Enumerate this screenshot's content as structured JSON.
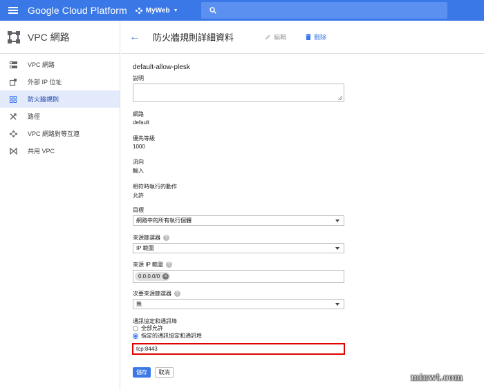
{
  "topbar": {
    "app_title": "Google Cloud Platform",
    "project": "MyWeb",
    "brand_color": "#3b78e7"
  },
  "sidebar": {
    "title": "VPC 網路",
    "items": [
      {
        "label": "VPC 網路",
        "icon": "network-icon",
        "active": false
      },
      {
        "label": "外部 IP 位址",
        "icon": "external-ip-icon",
        "active": false
      },
      {
        "label": "防火牆規則",
        "icon": "firewall-icon",
        "active": true
      },
      {
        "label": "路徑",
        "icon": "routes-icon",
        "active": false
      },
      {
        "label": "VPC 網路對等互連",
        "icon": "peering-icon",
        "active": false
      },
      {
        "label": "共用 VPC",
        "icon": "shared-vpc-icon",
        "active": false
      }
    ]
  },
  "header": {
    "title": "防火牆規則詳細資料",
    "edit_label": "編輯",
    "delete_label": "刪除"
  },
  "form": {
    "rule_name": "default-allow-plesk",
    "description_label": "說明",
    "network_label": "網路",
    "network_value": "default",
    "priority_label": "優先等級",
    "priority_value": "1000",
    "direction_label": "流向",
    "direction_value": "輸入",
    "action_label": "相符時執行的動作",
    "action_value": "允許",
    "target_label": "目標",
    "target_value": "網路中的所有執行個體",
    "source_filter_label": "來源篩選器",
    "source_filter_value": "IP 範圍",
    "source_ip_label": "來源 IP 範圍",
    "source_ip_chip": "0.0.0.0/0",
    "secondary_filter_label": "次要來源篩選器",
    "secondary_filter_value": "無",
    "protocols_label": "通訊協定和通訊埠",
    "allow_all_label": "全部允許",
    "specified_label": "指定的通訊協定和通訊埠",
    "ports_value": "tcp:8443",
    "save_label": "儲存",
    "cancel_label": "取消"
  },
  "watermark": "minwt.com"
}
